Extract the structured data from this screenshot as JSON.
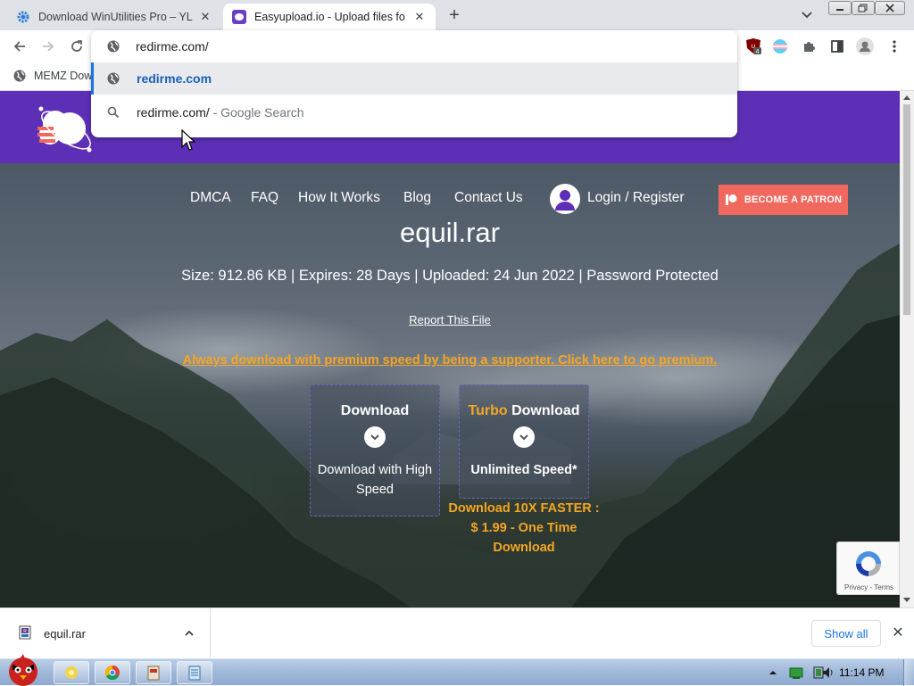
{
  "browser": {
    "tabs": [
      {
        "title": "Download WinUtilities Pro – YL",
        "active": false
      },
      {
        "title": "Easyupload.io - Upload files fo",
        "active": true
      }
    ],
    "address": "redirme.com/",
    "bookmark_label": "MEMZ Dow",
    "extension_badge": "4",
    "suggestions": [
      {
        "text": "redirme.com",
        "hint": "",
        "icon": "globe-icon"
      },
      {
        "text": "redirme.com/",
        "hint": "- Google Search",
        "icon": "search-icon"
      }
    ]
  },
  "page": {
    "nav": {
      "dmca": "DMCA",
      "faq": "FAQ",
      "how": "How It Works",
      "blog": "Blog",
      "contact": "Contact Us",
      "login": "Login / Register",
      "patron": "BECOME A PATRON"
    },
    "file_name": "equil.rar",
    "file_meta": "Size: 912.86 KB | Expires: 28 Days | Uploaded: 24 Jun 2022 | Password Protected",
    "report": "Report This File",
    "premium_link": "Always download with premium speed by being a supporter. Click here to go premium.",
    "download_box": {
      "title": "Download",
      "subtitle": "Download with High Speed"
    },
    "turbo_box": {
      "title_accent": "Turbo",
      "title_rest": "Download",
      "subtitle": "Unlimited Speed*",
      "note": "Download 10X FASTER : $ 1.99 - One Time Download"
    },
    "recaptcha_terms": "Privacy - Terms"
  },
  "download_bar": {
    "file": "equil.rar",
    "show_all": "Show all"
  },
  "taskbar": {
    "clock": "11:14 PM"
  },
  "colors": {
    "header_purple": "#5d2fb6",
    "accent_orange": "#f5a623",
    "patron_red": "#f1685e",
    "link_blue": "#1a73e8"
  }
}
